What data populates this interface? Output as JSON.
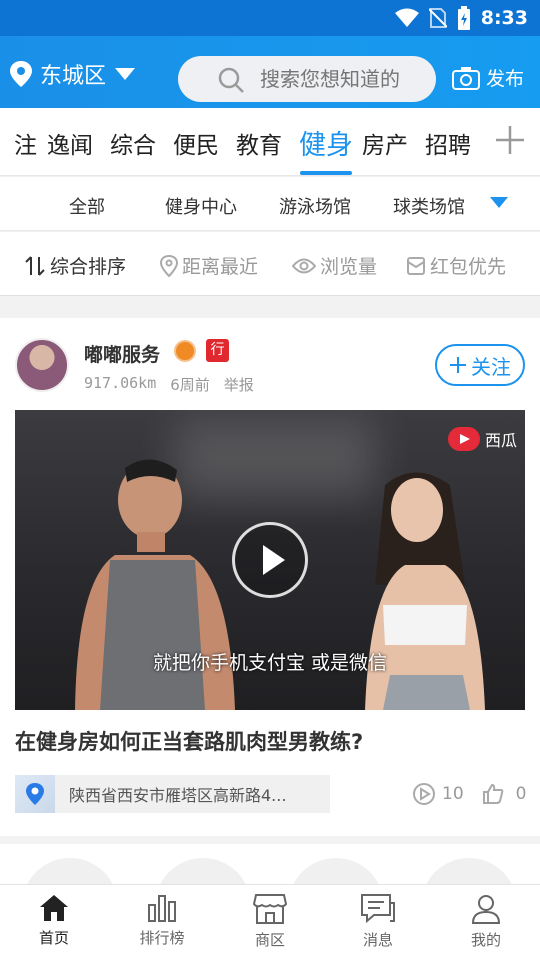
{
  "status": {
    "time": "8:33"
  },
  "header": {
    "location": "东城区",
    "search_placeholder": "搜索您想知道的",
    "publish_label": "发布"
  },
  "tabs": [
    "注",
    "逸闻",
    "综合",
    "便民",
    "教育",
    "健身",
    "房产",
    "招聘"
  ],
  "active_tab": "健身",
  "subtabs": [
    "全部",
    "健身中心",
    "游泳场馆",
    "球类场馆"
  ],
  "sort_options": [
    "综合排序",
    "距离最近",
    "浏览量",
    "红包优先"
  ],
  "post": {
    "author": "嘟嘟服务",
    "badge": "行",
    "distance": "917.06km",
    "time": "6周前",
    "report": "举报",
    "follow_label": "关注",
    "video_subtitle": "就把你手机支付宝 或是微信",
    "video_watermark": "西瓜",
    "title": "在健身房如何正当套路肌肉型男教练?",
    "address": "陕西省西安市雁塔区高新路4...",
    "views": "10",
    "likes": "0"
  },
  "bottom_nav": [
    "首页",
    "排行榜",
    "商区",
    "消息",
    "我的"
  ],
  "colors": {
    "accent": "#1c93ee",
    "header": "#1a8fe8",
    "status_bar": "#0e74d4"
  }
}
